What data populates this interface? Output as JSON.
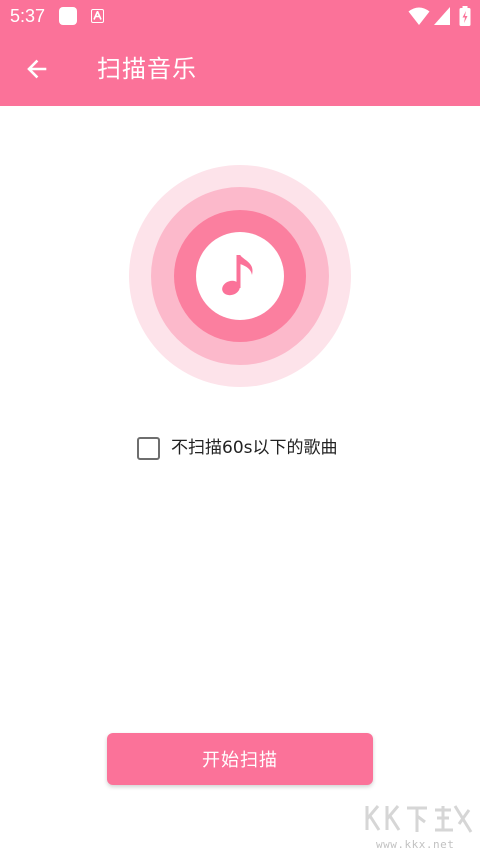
{
  "status_bar": {
    "time": "5:37",
    "icons": [
      "notification-square-icon",
      "a-app-icon",
      "wifi-icon",
      "signal-icon",
      "battery-charging-icon"
    ]
  },
  "toolbar": {
    "title": "扫描音乐",
    "back_icon": "arrow-back-icon"
  },
  "illustration": {
    "icon": "music-note-icon",
    "colors": {
      "outer_ring": "#fde3ea",
      "middle_ring": "#fcb9cb",
      "inner_ring": "#fb7f9f",
      "center": "#ffffff"
    }
  },
  "filter": {
    "label": "不扫描60s以下的歌曲",
    "checked": false
  },
  "actions": {
    "start_label": "开始扫描"
  },
  "watermark": {
    "url": "www.kkx.net"
  },
  "theme": {
    "accent": "#fb7299",
    "text_primary": "#222222"
  }
}
